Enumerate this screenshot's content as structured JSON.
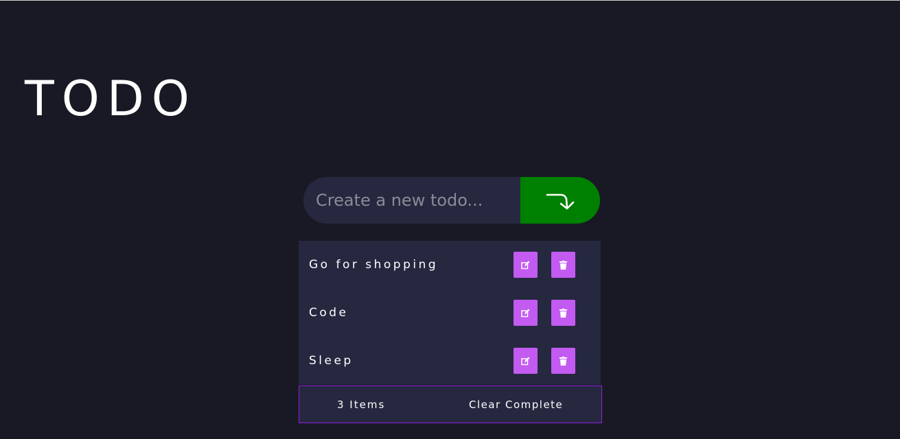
{
  "app": {
    "title": "TODO"
  },
  "input": {
    "placeholder": "Create a new todo...",
    "value": ""
  },
  "add_button": {
    "icon": "arrow-turn-down-right-icon",
    "color": "#008000"
  },
  "todos": [
    {
      "text": "Go for shopping",
      "edit_icon": "edit-icon",
      "delete_icon": "trash-icon"
    },
    {
      "text": "Code",
      "edit_icon": "edit-icon",
      "delete_icon": "trash-icon"
    },
    {
      "text": "Sleep",
      "edit_icon": "edit-icon",
      "delete_icon": "trash-icon"
    }
  ],
  "footer": {
    "items_count": "3 Items",
    "clear_label": "Clear Complete"
  },
  "colors": {
    "background": "#191925",
    "panel": "#262840",
    "accent": "#c35bf2",
    "footer_border": "#8f1ee0"
  }
}
